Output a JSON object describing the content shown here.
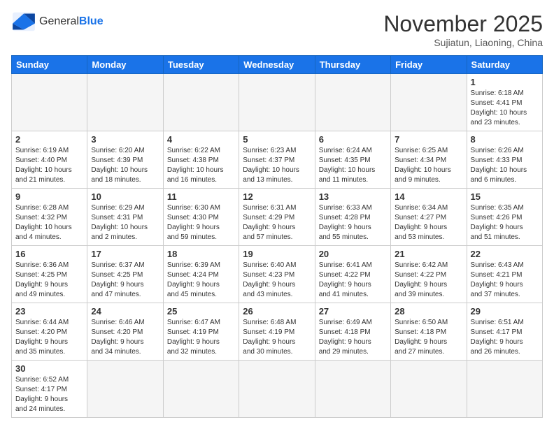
{
  "header": {
    "logo_general": "General",
    "logo_blue": "Blue",
    "month_title": "November 2025",
    "location": "Sujiatun, Liaoning, China"
  },
  "weekdays": [
    "Sunday",
    "Monday",
    "Tuesday",
    "Wednesday",
    "Thursday",
    "Friday",
    "Saturday"
  ],
  "days": [
    {
      "num": "",
      "info": ""
    },
    {
      "num": "",
      "info": ""
    },
    {
      "num": "",
      "info": ""
    },
    {
      "num": "",
      "info": ""
    },
    {
      "num": "",
      "info": ""
    },
    {
      "num": "",
      "info": ""
    },
    {
      "num": "1",
      "info": "Sunrise: 6:18 AM\nSunset: 4:41 PM\nDaylight: 10 hours\nand 23 minutes."
    },
    {
      "num": "2",
      "info": "Sunrise: 6:19 AM\nSunset: 4:40 PM\nDaylight: 10 hours\nand 21 minutes."
    },
    {
      "num": "3",
      "info": "Sunrise: 6:20 AM\nSunset: 4:39 PM\nDaylight: 10 hours\nand 18 minutes."
    },
    {
      "num": "4",
      "info": "Sunrise: 6:22 AM\nSunset: 4:38 PM\nDaylight: 10 hours\nand 16 minutes."
    },
    {
      "num": "5",
      "info": "Sunrise: 6:23 AM\nSunset: 4:37 PM\nDaylight: 10 hours\nand 13 minutes."
    },
    {
      "num": "6",
      "info": "Sunrise: 6:24 AM\nSunset: 4:35 PM\nDaylight: 10 hours\nand 11 minutes."
    },
    {
      "num": "7",
      "info": "Sunrise: 6:25 AM\nSunset: 4:34 PM\nDaylight: 10 hours\nand 9 minutes."
    },
    {
      "num": "8",
      "info": "Sunrise: 6:26 AM\nSunset: 4:33 PM\nDaylight: 10 hours\nand 6 minutes."
    },
    {
      "num": "9",
      "info": "Sunrise: 6:28 AM\nSunset: 4:32 PM\nDaylight: 10 hours\nand 4 minutes."
    },
    {
      "num": "10",
      "info": "Sunrise: 6:29 AM\nSunset: 4:31 PM\nDaylight: 10 hours\nand 2 minutes."
    },
    {
      "num": "11",
      "info": "Sunrise: 6:30 AM\nSunset: 4:30 PM\nDaylight: 9 hours\nand 59 minutes."
    },
    {
      "num": "12",
      "info": "Sunrise: 6:31 AM\nSunset: 4:29 PM\nDaylight: 9 hours\nand 57 minutes."
    },
    {
      "num": "13",
      "info": "Sunrise: 6:33 AM\nSunset: 4:28 PM\nDaylight: 9 hours\nand 55 minutes."
    },
    {
      "num": "14",
      "info": "Sunrise: 6:34 AM\nSunset: 4:27 PM\nDaylight: 9 hours\nand 53 minutes."
    },
    {
      "num": "15",
      "info": "Sunrise: 6:35 AM\nSunset: 4:26 PM\nDaylight: 9 hours\nand 51 minutes."
    },
    {
      "num": "16",
      "info": "Sunrise: 6:36 AM\nSunset: 4:25 PM\nDaylight: 9 hours\nand 49 minutes."
    },
    {
      "num": "17",
      "info": "Sunrise: 6:37 AM\nSunset: 4:25 PM\nDaylight: 9 hours\nand 47 minutes."
    },
    {
      "num": "18",
      "info": "Sunrise: 6:39 AM\nSunset: 4:24 PM\nDaylight: 9 hours\nand 45 minutes."
    },
    {
      "num": "19",
      "info": "Sunrise: 6:40 AM\nSunset: 4:23 PM\nDaylight: 9 hours\nand 43 minutes."
    },
    {
      "num": "20",
      "info": "Sunrise: 6:41 AM\nSunset: 4:22 PM\nDaylight: 9 hours\nand 41 minutes."
    },
    {
      "num": "21",
      "info": "Sunrise: 6:42 AM\nSunset: 4:22 PM\nDaylight: 9 hours\nand 39 minutes."
    },
    {
      "num": "22",
      "info": "Sunrise: 6:43 AM\nSunset: 4:21 PM\nDaylight: 9 hours\nand 37 minutes."
    },
    {
      "num": "23",
      "info": "Sunrise: 6:44 AM\nSunset: 4:20 PM\nDaylight: 9 hours\nand 35 minutes."
    },
    {
      "num": "24",
      "info": "Sunrise: 6:46 AM\nSunset: 4:20 PM\nDaylight: 9 hours\nand 34 minutes."
    },
    {
      "num": "25",
      "info": "Sunrise: 6:47 AM\nSunset: 4:19 PM\nDaylight: 9 hours\nand 32 minutes."
    },
    {
      "num": "26",
      "info": "Sunrise: 6:48 AM\nSunset: 4:19 PM\nDaylight: 9 hours\nand 30 minutes."
    },
    {
      "num": "27",
      "info": "Sunrise: 6:49 AM\nSunset: 4:18 PM\nDaylight: 9 hours\nand 29 minutes."
    },
    {
      "num": "28",
      "info": "Sunrise: 6:50 AM\nSunset: 4:18 PM\nDaylight: 9 hours\nand 27 minutes."
    },
    {
      "num": "29",
      "info": "Sunrise: 6:51 AM\nSunset: 4:17 PM\nDaylight: 9 hours\nand 26 minutes."
    },
    {
      "num": "30",
      "info": "Sunrise: 6:52 AM\nSunset: 4:17 PM\nDaylight: 9 hours\nand 24 minutes."
    },
    {
      "num": "",
      "info": ""
    },
    {
      "num": "",
      "info": ""
    },
    {
      "num": "",
      "info": ""
    },
    {
      "num": "",
      "info": ""
    },
    {
      "num": "",
      "info": ""
    },
    {
      "num": "",
      "info": ""
    }
  ]
}
